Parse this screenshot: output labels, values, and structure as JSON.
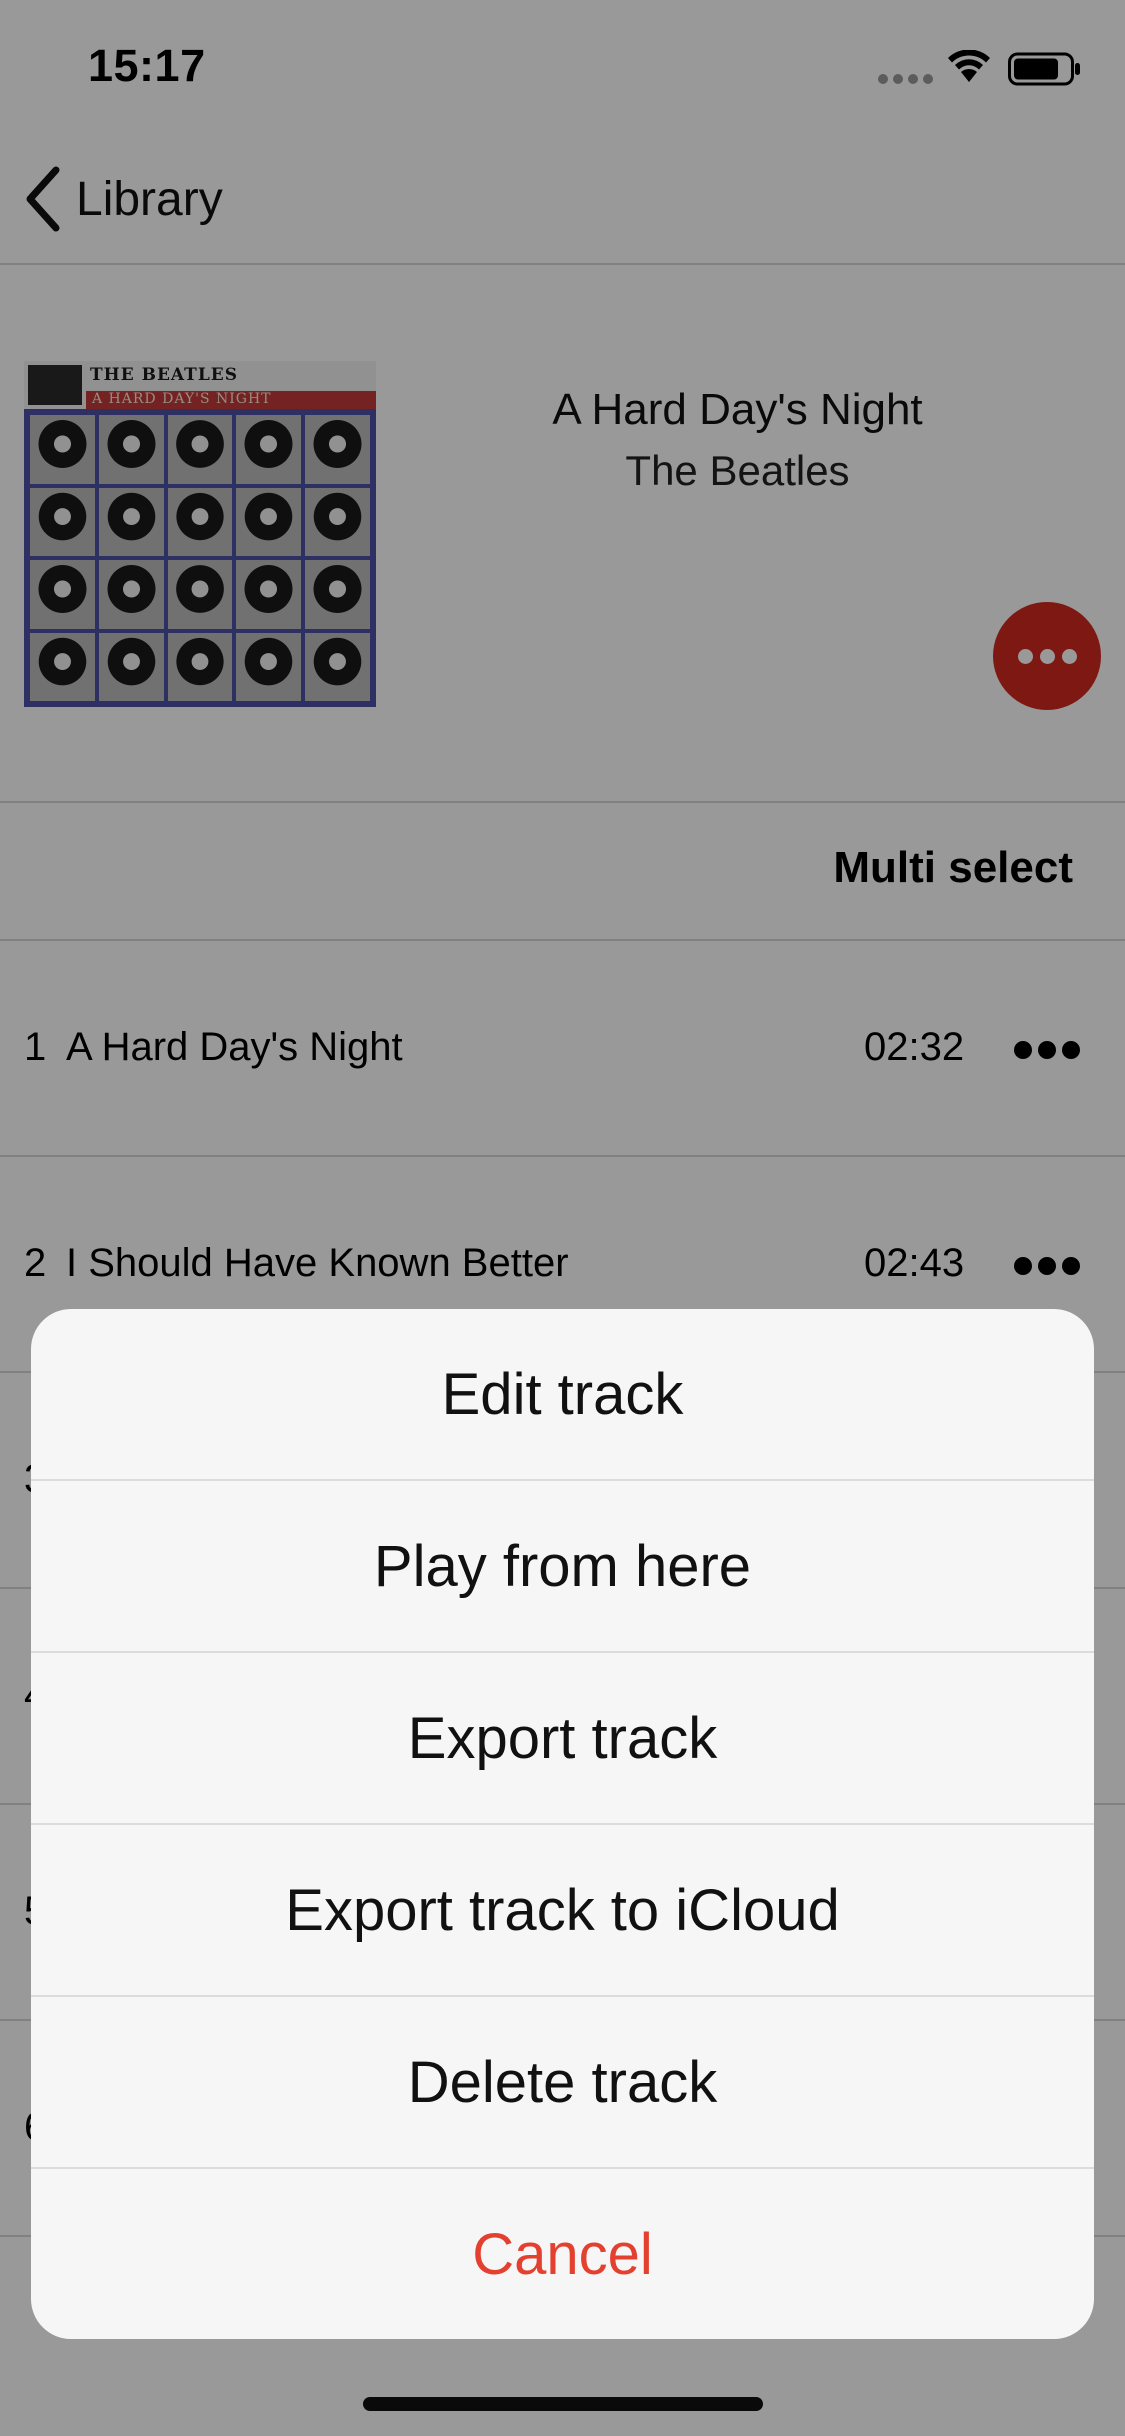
{
  "status_bar": {
    "time": "15:17",
    "icons": [
      "cellular-dots-icon",
      "wifi-icon",
      "battery-icon"
    ]
  },
  "nav": {
    "back_label": "Library",
    "back_icon": "chevron-left-icon"
  },
  "album": {
    "title": "A Hard Day's Night",
    "artist": "The Beatles",
    "cover_text_band": "THE BEATLES",
    "cover_text_album": "A HARD DAY'S NIGHT",
    "more_button_color": "#d0281f"
  },
  "toolbar": {
    "multi_select_label": "Multi select"
  },
  "tracks": [
    {
      "number": "1",
      "title": "A Hard Day's Night",
      "duration": "02:32"
    },
    {
      "number": "2",
      "title": "I Should Have Known Better",
      "duration": "02:43"
    },
    {
      "number": "3",
      "title": "",
      "duration": ""
    },
    {
      "number": "4",
      "title": "",
      "duration": ""
    },
    {
      "number": "5",
      "title": "",
      "duration": ""
    },
    {
      "number": "6",
      "title": "",
      "duration": ""
    }
  ],
  "action_sheet": {
    "items": [
      {
        "label": "Edit track"
      },
      {
        "label": "Play from here"
      },
      {
        "label": "Export track"
      },
      {
        "label": "Export track to iCloud"
      },
      {
        "label": "Delete track"
      }
    ],
    "cancel_label": "Cancel",
    "cancel_color": "#e3402f"
  }
}
